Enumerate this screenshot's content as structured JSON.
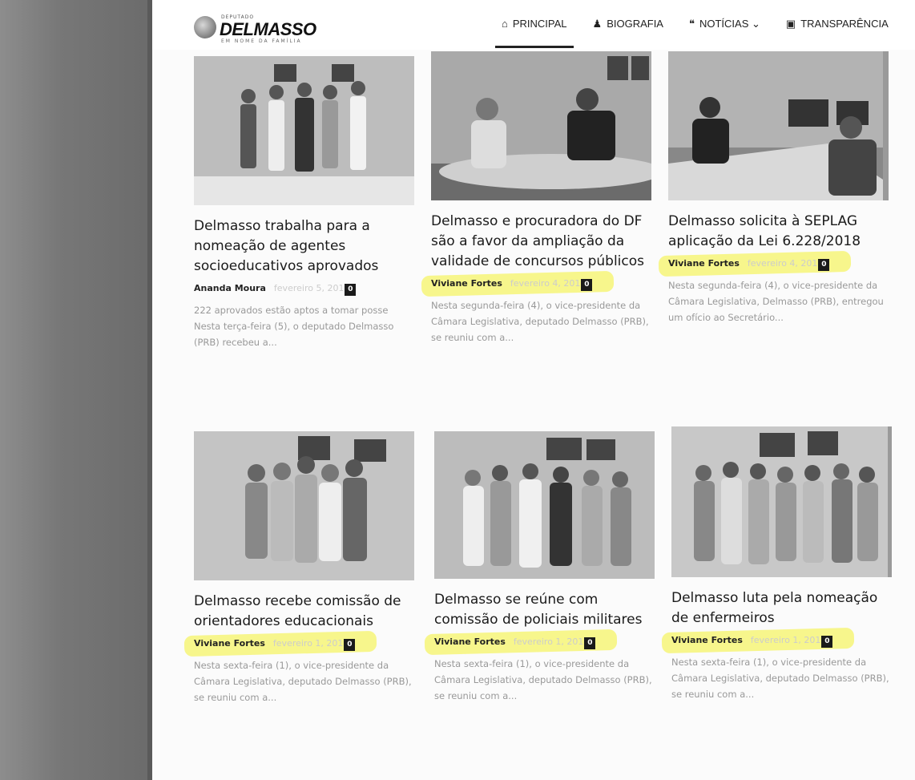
{
  "header": {
    "logo_small": "DEPUTADO",
    "logo_text": "DELMASSO",
    "logo_tag": "EM NOME DA FAMÍLIA",
    "nav": [
      {
        "icon": "⌂",
        "label": "PRINCIPAL"
      },
      {
        "icon": "♟",
        "label": "BIOGRAFIA"
      },
      {
        "icon": "❝",
        "label": "NOTÍCIAS ⌄"
      },
      {
        "icon": "▣",
        "label": "TRANSPARÊNCIA"
      }
    ]
  },
  "posts": [
    {
      "title": "Delmasso trabalha para a nomeação de agentes socioeducativos aprovados",
      "author": "Ananda Moura",
      "date": "fevereiro 5, 2019",
      "comments": "0",
      "excerpt": "222 aprovados estão aptos a tomar posse Nesta terça-feira (5), o deputado Delmasso (PRB) recebeu a..."
    },
    {
      "title": "Delmasso e procuradora do DF são a favor da ampliação da validade de concursos públicos",
      "author": "Viviane Fortes",
      "date": "fevereiro 4, 2019",
      "comments": "0",
      "excerpt": "Nesta segunda-feira (4), o vice-presidente da Câmara Legislativa, deputado Delmasso (PRB), se reuniu com a..."
    },
    {
      "title": "Delmasso solicita à SEPLAG aplicação da Lei 6.228/2018",
      "author": "Viviane Fortes",
      "date": "fevereiro 4, 2019",
      "comments": "0",
      "excerpt": "Nesta segunda-feira (4), o vice-presidente da Câmara Legislativa, Delmasso (PRB), entregou um ofício ao Secretário..."
    },
    {
      "title": "Delmasso recebe comissão de orientadores educacionais",
      "author": "Viviane Fortes",
      "date": "fevereiro 1, 2019",
      "comments": "0",
      "excerpt": "Nesta sexta-feira (1), o vice-presidente da Câmara Legislativa, deputado Delmasso (PRB), se reuniu com a..."
    },
    {
      "title": "Delmasso se reúne com comissão de policiais militares",
      "author": "Viviane Fortes",
      "date": "fevereiro 1, 2019",
      "comments": "0",
      "excerpt": "Nesta sexta-feira (1), o vice-presidente da Câmara Legislativa, deputado Delmasso (PRB), se reuniu com a..."
    },
    {
      "title": "Delmasso luta pela nomeação de enfermeiros",
      "author": "Viviane Fortes",
      "date": "fevereiro 1, 2019",
      "comments": "0",
      "excerpt": "Nesta sexta-feira (1), o vice-presidente da Câmara Legislativa, deputado Delmasso (PRB), se reuniu com a..."
    }
  ],
  "colors": {
    "highlight": "#f6f578",
    "badge": "#1a1a1a",
    "sidebar": "#777777"
  }
}
